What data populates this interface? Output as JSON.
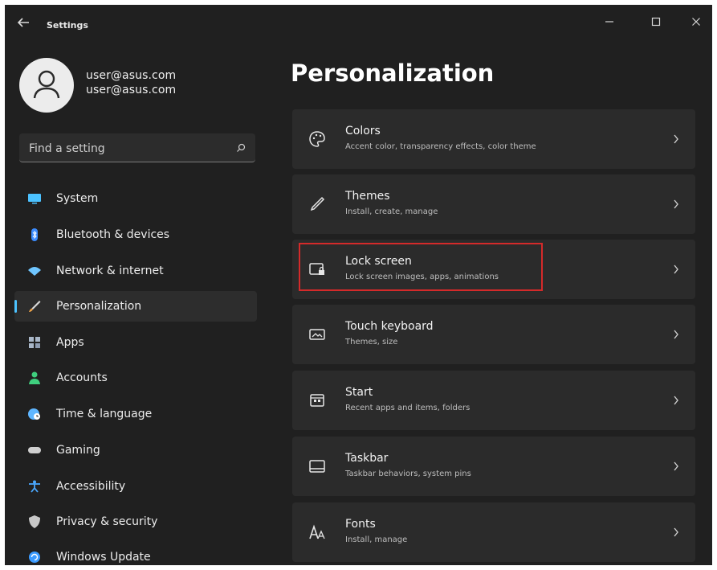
{
  "window": {
    "title": "Settings"
  },
  "user": {
    "name": "user@asus.com",
    "email": "user@asus.com"
  },
  "search": {
    "placeholder": "Find a setting",
    "icon": "search-icon"
  },
  "sidebar": {
    "items": [
      {
        "label": "System",
        "icon": "monitor-icon",
        "color": "#4cc2ff"
      },
      {
        "label": "Bluetooth & devices",
        "icon": "bluetooth-icon",
        "color": "#3b8cff"
      },
      {
        "label": "Network & internet",
        "icon": "wifi-icon",
        "color": "#6fc6ff"
      },
      {
        "label": "Personalization",
        "icon": "brush-icon",
        "color": "#f0a54a",
        "active": true
      },
      {
        "label": "Apps",
        "icon": "apps-icon",
        "color": "#a9b7c8"
      },
      {
        "label": "Accounts",
        "icon": "person-icon",
        "color": "#3fcf7e"
      },
      {
        "label": "Time & language",
        "icon": "globe-clock-icon",
        "color": "#5fb6ff"
      },
      {
        "label": "Gaming",
        "icon": "gamepad-icon",
        "color": "#cfcfcf"
      },
      {
        "label": "Accessibility",
        "icon": "accessibility-icon",
        "color": "#4aa8ff"
      },
      {
        "label": "Privacy & security",
        "icon": "shield-icon",
        "color": "#c8c8c8"
      },
      {
        "label": "Windows Update",
        "icon": "update-icon",
        "color": "#3b9bff"
      }
    ]
  },
  "main": {
    "title": "Personalization",
    "cards": [
      {
        "title": "Colors",
        "subtitle": "Accent color, transparency effects, color theme",
        "icon": "palette-icon"
      },
      {
        "title": "Themes",
        "subtitle": "Install, create, manage",
        "icon": "pen-icon"
      },
      {
        "title": "Lock screen",
        "subtitle": "Lock screen images, apps, animations",
        "icon": "lock-screen-icon",
        "highlighted": true
      },
      {
        "title": "Touch keyboard",
        "subtitle": "Themes, size",
        "icon": "keyboard-icon"
      },
      {
        "title": "Start",
        "subtitle": "Recent apps and items, folders",
        "icon": "start-menu-icon"
      },
      {
        "title": "Taskbar",
        "subtitle": "Taskbar behaviors, system pins",
        "icon": "taskbar-icon"
      },
      {
        "title": "Fonts",
        "subtitle": "Install, manage",
        "icon": "fonts-icon"
      }
    ]
  },
  "colors": {
    "highlight": "#d42a2a",
    "accent": "#4cc2ff",
    "background": "#202020",
    "card": "#2b2b2b"
  }
}
